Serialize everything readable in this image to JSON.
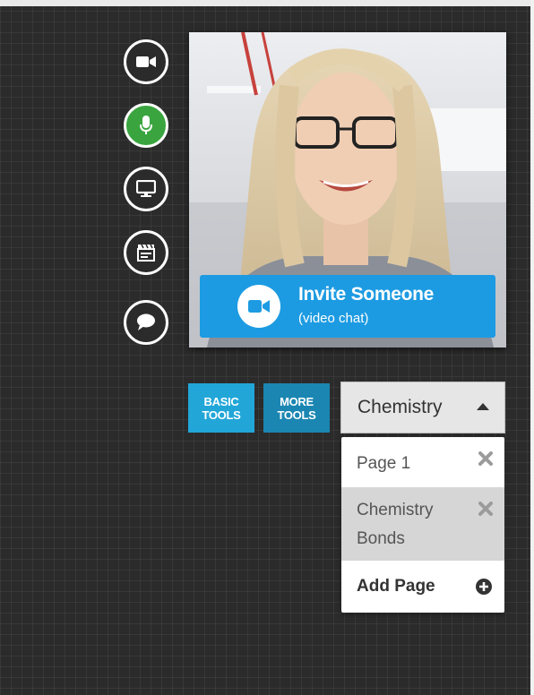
{
  "video": {
    "invite_title": "Invite Someone",
    "invite_subtitle": "(video chat)"
  },
  "toolbar": {
    "basic_tools_label": "BASIC TOOLS",
    "more_tools_label": "MORE TOOLS"
  },
  "notebook": {
    "dropdown_label": "Chemistry",
    "pages": [
      {
        "label": "Page 1"
      },
      {
        "label": "Chemistry Bonds"
      }
    ],
    "add_page_label": "Add Page"
  },
  "side_buttons": [
    {
      "icon": "video-camera-icon",
      "active": false
    },
    {
      "icon": "microphone-icon",
      "active": true
    },
    {
      "icon": "screen-share-icon",
      "active": false
    },
    {
      "icon": "clapperboard-icon",
      "active": false
    },
    {
      "icon": "chat-bubble-icon",
      "active": false
    }
  ],
  "colors": {
    "accent_blue": "#1d9be2",
    "mic_active_green": "#3aa53f",
    "basic_tools": "#22a6d8",
    "more_tools": "#1b86b2",
    "background": "#2b2b2b"
  }
}
